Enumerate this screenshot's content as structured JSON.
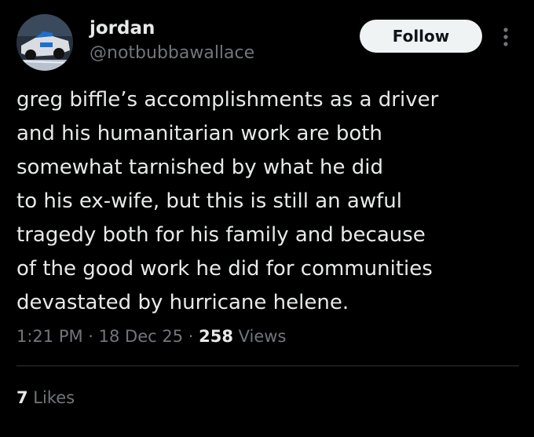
{
  "author": {
    "display_name": "jordan",
    "handle": "@notbubbawallace",
    "avatar_icon": "racing-car-avatar"
  },
  "follow_button": {
    "label": "Follow"
  },
  "more_menu": {
    "icon": "more-vertical-icon"
  },
  "tweet": {
    "lines": [
      "greg biffle’s accomplishments as a driver",
      "and his humanitarian work are both",
      "somewhat tarnished by what he did",
      "to his ex-wife, but this is still an awful",
      "tragedy both for his family and because",
      "of the good work he did for communities",
      "devastated by hurricane helene."
    ]
  },
  "meta": {
    "time": "1:21 PM",
    "separator": " · ",
    "date": "18 Dec 25",
    "views_count": "258",
    "views_label": " Views"
  },
  "engagement": {
    "likes_count": "7",
    "likes_label": " Likes"
  },
  "colors": {
    "background": "#000000",
    "primary_text": "#e7e9ea",
    "secondary_text": "#71767b",
    "button_bg": "#eff3f4",
    "button_text": "#0f1419",
    "divider": "#2f3336"
  }
}
